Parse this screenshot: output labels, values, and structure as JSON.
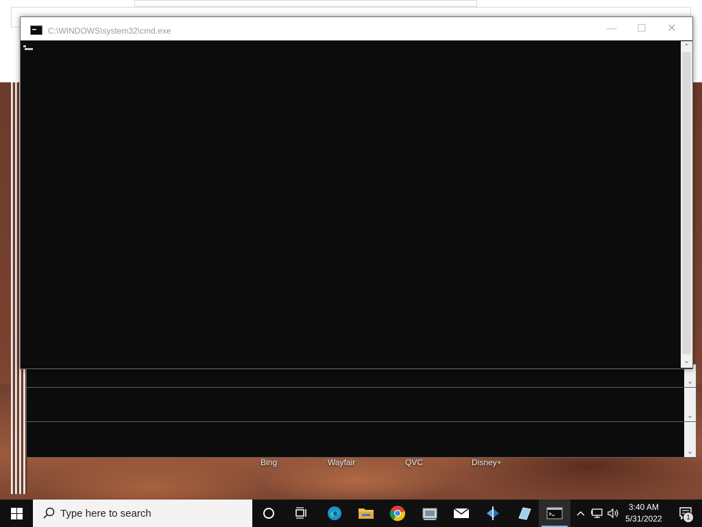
{
  "window": {
    "title": "C:\\WINDOWS\\system32\\cmd.exe",
    "minimize_glyph": "—",
    "maximize_glyph": "☐",
    "close_glyph": "✕"
  },
  "console": {
    "text": ""
  },
  "desktop": {
    "shortcut_labels": [
      "Bing",
      "Wayfair",
      "QVC",
      "Disney+"
    ]
  },
  "taskbar": {
    "search_placeholder": "Type here to search",
    "pinned": [
      {
        "name": "cortana",
        "icon": "cortana-circle-icon"
      },
      {
        "name": "task-view",
        "icon": "task-view-icon"
      },
      {
        "name": "edge",
        "icon": "edge-icon"
      },
      {
        "name": "file-explorer",
        "icon": "folder-icon"
      },
      {
        "name": "chrome",
        "icon": "chrome-icon"
      },
      {
        "name": "app",
        "icon": "app-icon"
      },
      {
        "name": "mail",
        "icon": "mail-icon"
      },
      {
        "name": "app",
        "icon": "app-icon"
      },
      {
        "name": "app",
        "icon": "app-icon"
      },
      {
        "name": "cmd",
        "icon": "cmd-icon",
        "active": true
      }
    ],
    "tray": {
      "time": "3:40 AM",
      "date": "5/31/2022",
      "notification_count": "1"
    }
  },
  "colors": {
    "console_bg": "#0c0c0c",
    "taskbar_bg": "#101010",
    "accent": "#76b9ed"
  }
}
